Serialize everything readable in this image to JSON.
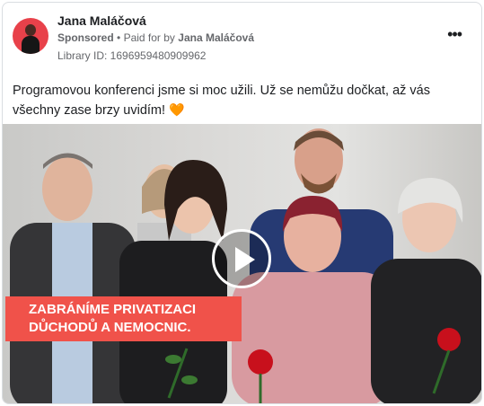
{
  "post": {
    "author": "Jana Maláčová",
    "sponsored_label": "Sponsored",
    "separator": "•",
    "paid_for_label": "Paid for by",
    "paid_for_name": "Jana Maláčová",
    "library_id": "Library ID: 1696959480909962",
    "more_label": "•••",
    "text": "Programovou konferenci jsme si moc užili. Už se nemůžu dočkat, až vás všechny zase brzy uvidím!",
    "emoji": "🧡"
  },
  "media": {
    "banner_line1": "ZABRÁNÍME PRIVATIZACI",
    "banner_line2": "DŮCHODŮ A NEMOCNIC.",
    "banner_color": "#f0524a",
    "play_icon": "play-icon"
  }
}
